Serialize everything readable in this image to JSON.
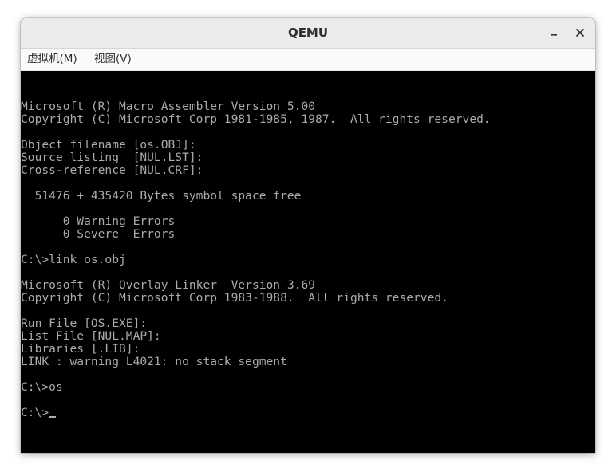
{
  "window": {
    "title": "QEMU",
    "controls": {
      "minimize_icon": "minimize-icon",
      "close_icon": "close-icon"
    }
  },
  "menu": {
    "items": [
      {
        "label": "虚拟机(M)"
      },
      {
        "label": "视图(V)"
      }
    ]
  },
  "console": {
    "lines": [
      "Microsoft (R) Macro Assembler Version 5.00",
      "Copyright (C) Microsoft Corp 1981-1985, 1987.  All rights reserved.",
      "",
      "Object filename [os.OBJ]:",
      "Source listing  [NUL.LST]:",
      "Cross-reference [NUL.CRF]:",
      "",
      "  51476 + 435420 Bytes symbol space free",
      "",
      "      0 Warning Errors",
      "      0 Severe  Errors",
      "",
      "C:\\>link os.obj",
      "",
      "Microsoft (R) Overlay Linker  Version 3.69",
      "Copyright (C) Microsoft Corp 1983-1988.  All rights reserved.",
      "",
      "Run File [OS.EXE]:",
      "List File [NUL.MAP]:",
      "Libraries [.LIB]:",
      "LINK : warning L4021: no stack segment",
      "",
      "C:\\>os",
      "",
      "C:\\>"
    ],
    "text_color": "#aaaaaa",
    "background": "#000000"
  }
}
